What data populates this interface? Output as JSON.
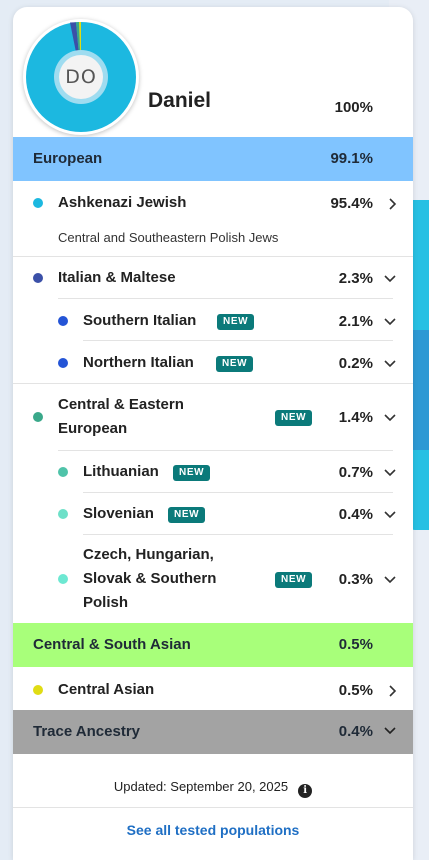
{
  "profile": {
    "initials": "DO",
    "name": "Daniel",
    "total": "100%"
  },
  "bands": {
    "european": {
      "label": "European",
      "pct": "99.1%",
      "color": "#80c4ff"
    },
    "central_south_asian": {
      "label": "Central & South Asian",
      "pct": "0.5%",
      "color": "#a8ff7a"
    },
    "trace": {
      "label": "Trace Ancestry",
      "pct": "0.4%",
      "color": "#a3a3a3"
    }
  },
  "items": {
    "ashkenazi": {
      "label": "Ashkenazi Jewish",
      "pct": "95.4%",
      "sub": "Central and Southeastern Polish Jews",
      "color": "#1cb8e0"
    },
    "italian_maltese": {
      "label": "Italian & Maltese",
      "pct": "2.3%",
      "color": "#3b50a8"
    },
    "southern_italian": {
      "label": "Southern Italian",
      "pct": "2.1%",
      "badge": "NEW",
      "color": "#2454d6"
    },
    "northern_italian": {
      "label": "Northern Italian",
      "pct": "0.2%",
      "badge": "NEW",
      "color": "#2454d6"
    },
    "central_eastern": {
      "label_line1": "Central & Eastern",
      "label_line2": "European",
      "pct": "1.4%",
      "badge": "NEW",
      "color": "#3aa88a"
    },
    "lithuanian": {
      "label": "Lithuanian",
      "pct": "0.7%",
      "badge": "NEW",
      "color": "#4fc3a9"
    },
    "slovenian": {
      "label": "Slovenian",
      "pct": "0.4%",
      "badge": "NEW",
      "color": "#6de0c8"
    },
    "czech": {
      "label_line1": "Czech, Hungarian,",
      "label_line2": "Slovak & Southern",
      "label_line3": "Polish",
      "pct": "0.3%",
      "badge": "NEW",
      "color": "#6de8d2"
    },
    "central_asian": {
      "label": "Central Asian",
      "pct": "0.5%",
      "color": "#e0dc14"
    }
  },
  "footer": {
    "updated": "Updated: September 20, 2025",
    "info_icon": "info-icon",
    "link": "See all tested populations"
  }
}
